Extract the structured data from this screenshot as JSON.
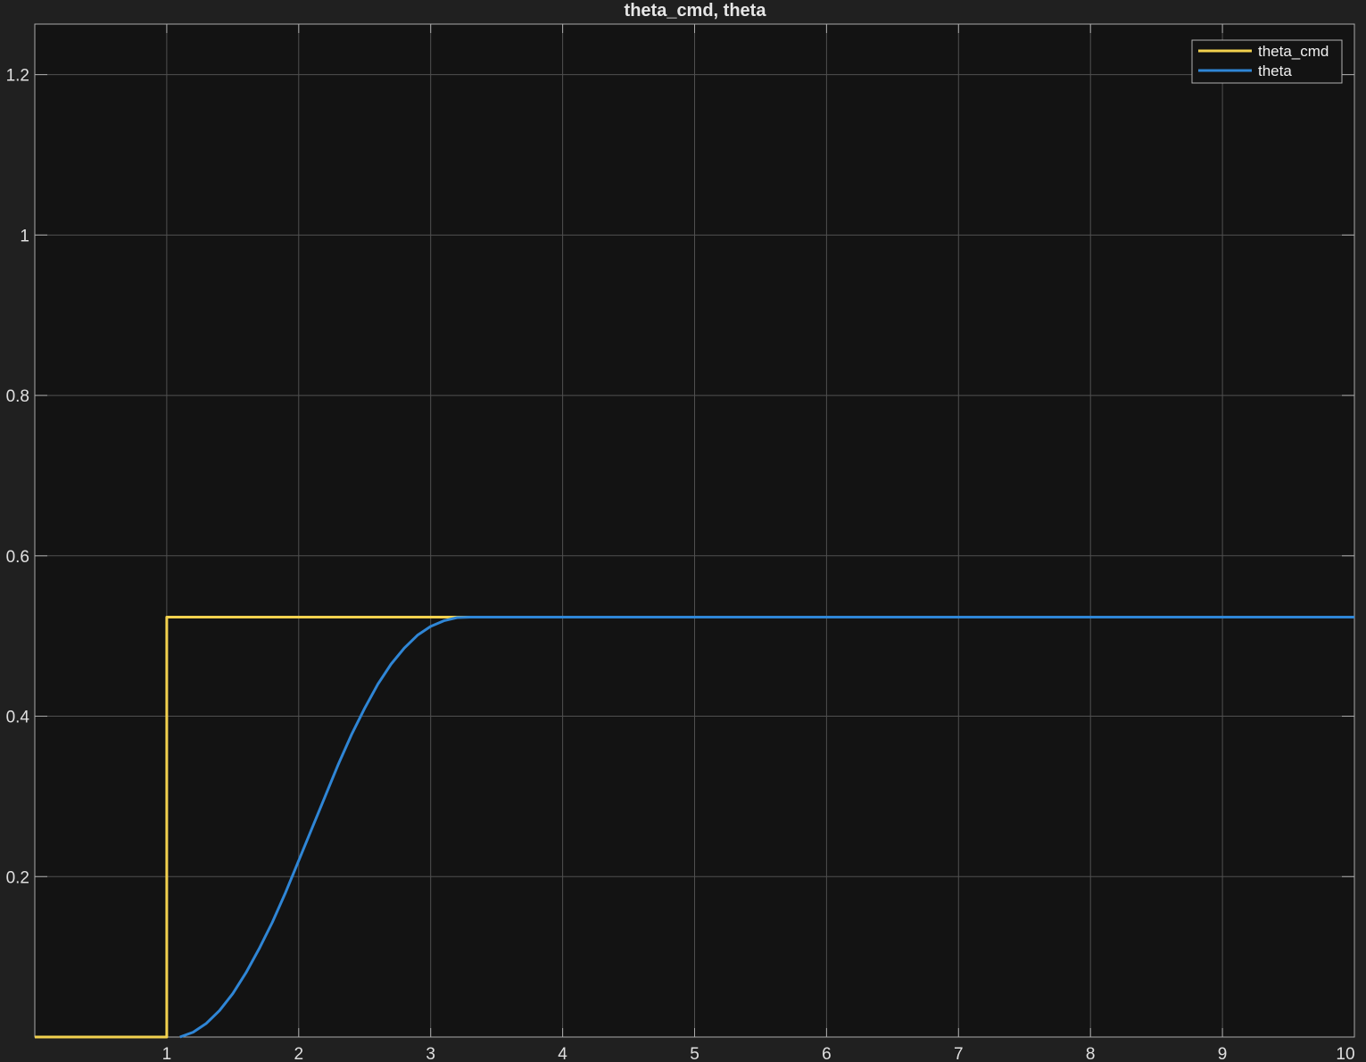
{
  "chart_data": {
    "type": "line",
    "title": "theta_cmd, theta",
    "xlabel": "",
    "ylabel": "",
    "xlim": [
      0,
      10
    ],
    "ylim": [
      0,
      1.263
    ],
    "xticks": [
      1,
      2,
      3,
      4,
      5,
      6,
      7,
      8,
      9,
      10
    ],
    "yticks": [
      0.2,
      0.4,
      0.6,
      0.8,
      1,
      1.2
    ],
    "grid": true,
    "legend_position": "top-right",
    "colors": {
      "background": "#202020",
      "plot_area": "#131313",
      "grid": "#505050",
      "axis": "#aaaaaa",
      "text": "#e0e0e0"
    },
    "series": [
      {
        "name": "theta_cmd",
        "color": "#f2d14e",
        "x": [
          0,
          1,
          1,
          10
        ],
        "y": [
          0,
          0,
          0.5236,
          0.5236
        ]
      },
      {
        "name": "theta",
        "color": "#2f86d6",
        "x": [
          1.1,
          1.2,
          1.3,
          1.4,
          1.5,
          1.6,
          1.7,
          1.8,
          1.9,
          2.0,
          2.1,
          2.2,
          2.3,
          2.4,
          2.5,
          2.6,
          2.7,
          2.8,
          2.9,
          3.0,
          3.1,
          3.2,
          3.3,
          4,
          5,
          6,
          7,
          8,
          9,
          10
        ],
        "y": [
          0,
          0.006,
          0.017,
          0.033,
          0.054,
          0.08,
          0.11,
          0.143,
          0.18,
          0.22,
          0.26,
          0.3,
          0.34,
          0.377,
          0.41,
          0.44,
          0.465,
          0.485,
          0.501,
          0.512,
          0.519,
          0.523,
          0.5236,
          0.5236,
          0.5236,
          0.5236,
          0.5236,
          0.5236,
          0.5236,
          0.5236
        ]
      }
    ]
  }
}
